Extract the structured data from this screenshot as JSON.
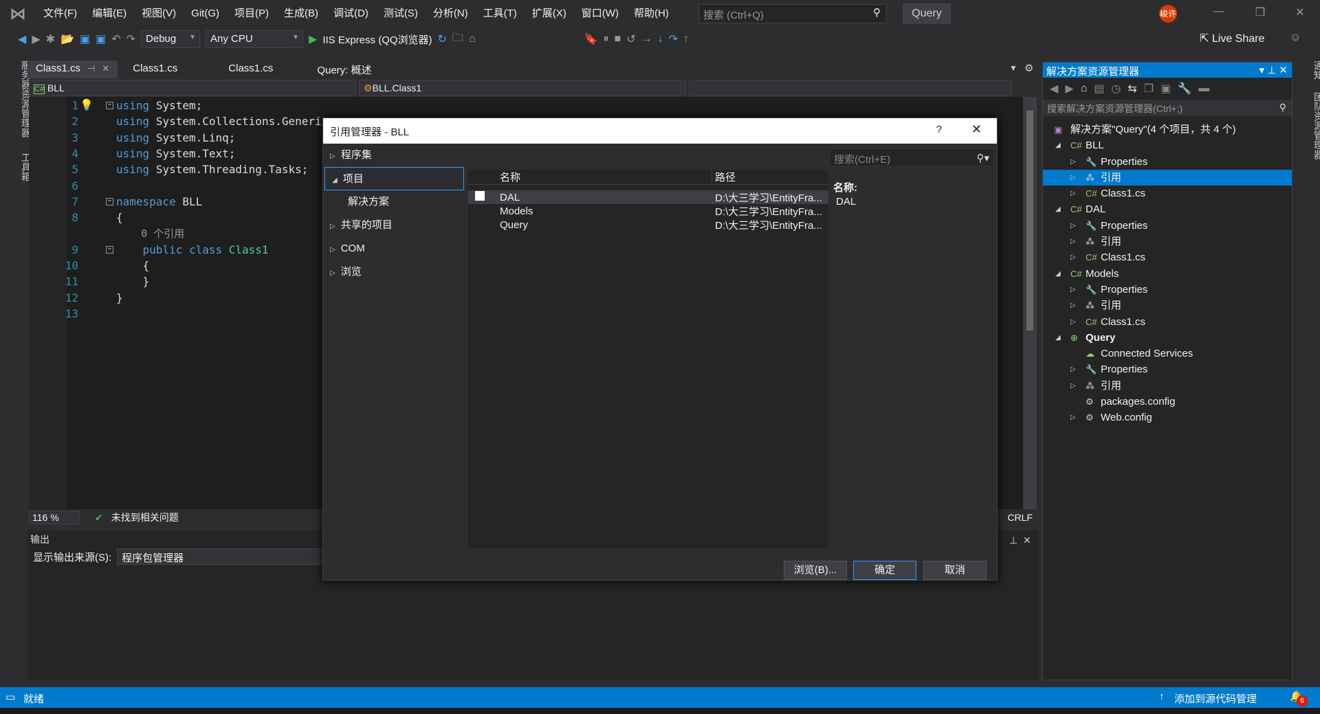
{
  "menu": {
    "items": [
      "文件(F)",
      "编辑(E)",
      "视图(V)",
      "Git(G)",
      "项目(P)",
      "生成(B)",
      "调试(D)",
      "测试(S)",
      "分析(N)",
      "工具(T)",
      "扩展(X)",
      "窗口(W)",
      "帮助(H)"
    ],
    "search_placeholder": "搜索 (Ctrl+Q)",
    "solution_name": "Query",
    "avatar": "峻许"
  },
  "toolbar": {
    "config": "Debug",
    "platform": "Any CPU",
    "run_target": "IIS Express (QQ浏览器)",
    "live_share": "Live Share"
  },
  "left_strip": {
    "server_explorer": "服务器资源管理器",
    "toolbox": "工具箱"
  },
  "right_strip": {
    "notifications": "通知",
    "team_explorer": "团队资源管理器"
  },
  "tabs": [
    "Class1.cs",
    "Class1.cs",
    "Class1.cs",
    "Query: 概述"
  ],
  "navbar": {
    "project": "BLL",
    "type": "BLL.Class1"
  },
  "code": [
    {
      "n": "1",
      "parts": [
        [
          "kw",
          "using"
        ],
        [
          "",
          "System;"
        ]
      ]
    },
    {
      "n": "2",
      "parts": [
        [
          "kw",
          "using"
        ],
        [
          "",
          "System.Collections.Generic;"
        ]
      ]
    },
    {
      "n": "3",
      "parts": [
        [
          "kw",
          "using"
        ],
        [
          "",
          "System.Linq;"
        ]
      ]
    },
    {
      "n": "4",
      "parts": [
        [
          "kw",
          "using"
        ],
        [
          "",
          "System.Text;"
        ]
      ]
    },
    {
      "n": "5",
      "parts": [
        [
          "kw",
          "using"
        ],
        [
          "",
          "System.Threading.Tasks;"
        ]
      ]
    },
    {
      "n": "6",
      "parts": []
    },
    {
      "n": "7",
      "parts": [
        [
          "kw",
          "namespace"
        ],
        [
          "",
          "BLL"
        ]
      ]
    },
    {
      "n": "8",
      "parts": [
        [
          "",
          "{"
        ]
      ]
    },
    {
      "n": "",
      "parts": [
        [
          "cl",
          "    0 个引用"
        ]
      ]
    },
    {
      "n": "9",
      "parts": [
        [
          "kw",
          "    public class"
        ],
        [
          "ty",
          "Class1"
        ]
      ]
    },
    {
      "n": "10",
      "parts": [
        [
          "",
          "    {"
        ]
      ]
    },
    {
      "n": "11",
      "parts": [
        [
          "",
          "    }"
        ]
      ]
    },
    {
      "n": "12",
      "parts": [
        [
          "",
          "}"
        ]
      ]
    },
    {
      "n": "13",
      "parts": []
    }
  ],
  "editor_status": {
    "zoom": "116 %",
    "issues": "未找到相关问题",
    "line_ending": "CRLF"
  },
  "output": {
    "title": "输出",
    "source_label": "显示输出来源(S):",
    "source_value": "程序包管理器"
  },
  "solution_explorer": {
    "title": "解决方案资源管理器",
    "search_placeholder": "搜索解决方案资源管理器(Ctrl+;)",
    "items": [
      {
        "label": "解决方案\"Query\"(4 个项目，共 4 个)",
        "level": 0,
        "exp": "",
        "icon": "solution-icon"
      },
      {
        "label": "BLL",
        "level": 1,
        "exp": "◢",
        "icon": "csharp-project-icon"
      },
      {
        "label": "Properties",
        "level": 2,
        "exp": "▷",
        "icon": "wrench-icon"
      },
      {
        "label": "引用",
        "level": 2,
        "exp": "▷",
        "icon": "references-icon",
        "selected": true
      },
      {
        "label": "Class1.cs",
        "level": 2,
        "exp": "▷",
        "icon": "csharp-file-icon"
      },
      {
        "label": "DAL",
        "level": 1,
        "exp": "◢",
        "icon": "csharp-project-icon"
      },
      {
        "label": "Properties",
        "level": 2,
        "exp": "▷",
        "icon": "wrench-icon"
      },
      {
        "label": "引用",
        "level": 2,
        "exp": "▷",
        "icon": "references-icon"
      },
      {
        "label": "Class1.cs",
        "level": 2,
        "exp": "▷",
        "icon": "csharp-file-icon"
      },
      {
        "label": "Models",
        "level": 1,
        "exp": "◢",
        "icon": "csharp-project-icon"
      },
      {
        "label": "Properties",
        "level": 2,
        "exp": "▷",
        "icon": "wrench-icon"
      },
      {
        "label": "引用",
        "level": 2,
        "exp": "▷",
        "icon": "references-icon"
      },
      {
        "label": "Class1.cs",
        "level": 2,
        "exp": "▷",
        "icon": "csharp-file-icon"
      },
      {
        "label": "Query",
        "level": 1,
        "exp": "◢",
        "icon": "web-project-icon",
        "bold": true
      },
      {
        "label": "Connected Services",
        "level": 2,
        "exp": "",
        "icon": "connected-services-icon"
      },
      {
        "label": "Properties",
        "level": 2,
        "exp": "▷",
        "icon": "wrench-icon"
      },
      {
        "label": "引用",
        "level": 2,
        "exp": "▷",
        "icon": "references-icon"
      },
      {
        "label": "packages.config",
        "level": 2,
        "exp": "",
        "icon": "config-file-icon"
      },
      {
        "label": "Web.config",
        "level": 2,
        "exp": "▷",
        "icon": "config-file-icon"
      }
    ]
  },
  "status": {
    "ready": "就绪",
    "source_control": "添加到源代码管理",
    "notification_count": "6"
  },
  "dialog": {
    "title": "引用管理器 - BLL",
    "help": "?",
    "nav": [
      {
        "label": "程序集",
        "arrow": "▷"
      },
      {
        "label": "项目",
        "arrow": "◢",
        "selected": true
      },
      {
        "label": "解决方案",
        "arrow": "",
        "sub": true
      },
      {
        "label": "共享的项目",
        "arrow": "▷"
      },
      {
        "label": "COM",
        "arrow": "▷"
      },
      {
        "label": "浏览",
        "arrow": "▷"
      }
    ],
    "search_placeholder": "搜索(Ctrl+E)",
    "columns": [
      "名称",
      "路径"
    ],
    "rows": [
      {
        "name": "DAL",
        "path": "D:\\大三学习\\EntityFra...",
        "selected": true
      },
      {
        "name": "Models",
        "path": "D:\\大三学习\\EntityFra..."
      },
      {
        "name": "Query",
        "path": "D:\\大三学习\\EntityFra..."
      }
    ],
    "detail_label": "名称:",
    "detail_value": "DAL",
    "buttons": {
      "browse": "浏览(B)...",
      "ok": "确定",
      "cancel": "取消"
    }
  },
  "colors": {
    "accent": "#007acc",
    "background": "#2d2d30",
    "editor": "#1e1e1e"
  }
}
